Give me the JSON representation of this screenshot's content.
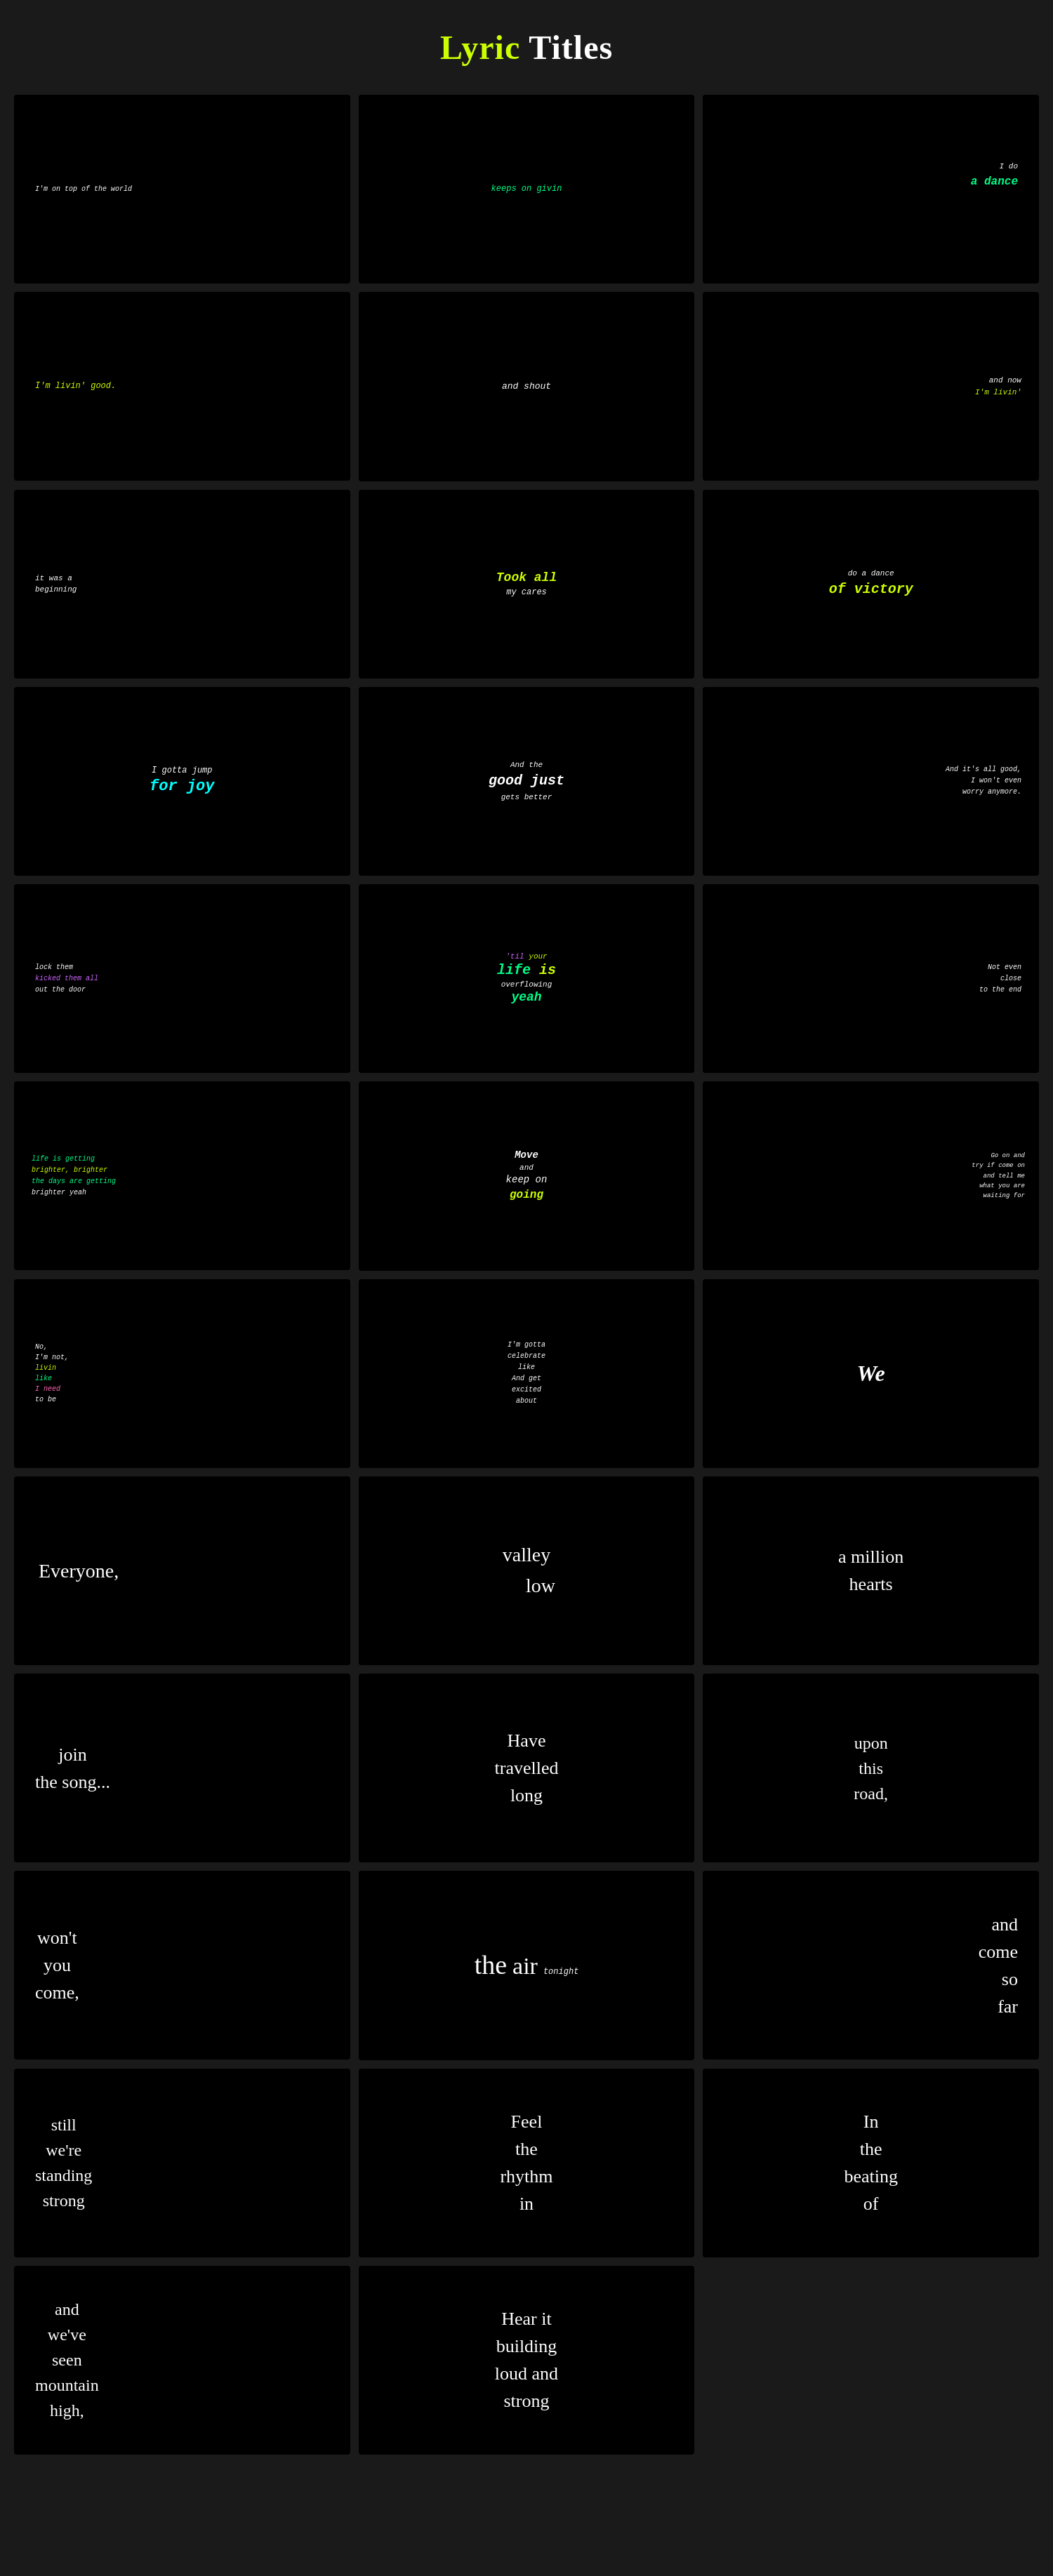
{
  "header": {
    "lyric": "Lyric",
    "titles": "Titles"
  },
  "cards": [
    {
      "id": 1,
      "lines": [
        {
          "text": "I'm on top of the world",
          "color": "white",
          "style": "italic small"
        }
      ],
      "align": "center",
      "position": "center-left"
    },
    {
      "id": 2,
      "lines": [
        {
          "text": "keeps on givin",
          "color": "green",
          "style": "italic"
        }
      ],
      "align": "center",
      "position": "center"
    },
    {
      "id": 3,
      "lines": [
        {
          "text": "I do",
          "color": "white",
          "style": "italic"
        },
        {
          "text": "a dance",
          "color": "green",
          "style": "italic bold"
        }
      ],
      "align": "right",
      "position": "top-right"
    },
    {
      "id": 4,
      "lines": [
        {
          "text": "I'm livin' good.",
          "color": "yellow",
          "style": "italic small"
        }
      ],
      "align": "left",
      "position": "center"
    },
    {
      "id": 5,
      "lines": [
        {
          "text": "and shout",
          "color": "white",
          "style": "italic"
        }
      ],
      "align": "center",
      "position": "center"
    },
    {
      "id": 6,
      "lines": [
        {
          "text": "and now",
          "color": "white",
          "style": "italic small"
        },
        {
          "text": "I'm livin'",
          "color": "yellow",
          "style": "italic small"
        }
      ],
      "align": "right",
      "position": "center"
    },
    {
      "id": 7,
      "lines": [
        {
          "text": "it was a",
          "color": "white",
          "style": "italic small"
        },
        {
          "text": "beginning",
          "color": "white",
          "style": "italic small"
        }
      ],
      "align": "left",
      "position": "center"
    },
    {
      "id": 8,
      "lines": [
        {
          "text": "Took all",
          "color": "yellow",
          "style": "bold-italic large"
        },
        {
          "text": "my cares",
          "color": "white",
          "style": "italic"
        }
      ],
      "align": "center",
      "position": "center"
    },
    {
      "id": 9,
      "lines": [
        {
          "text": "do a dance",
          "color": "white",
          "style": "italic small"
        },
        {
          "text": "of victory",
          "color": "yellow",
          "style": "bold-italic large"
        }
      ],
      "align": "center",
      "position": "center"
    },
    {
      "id": 10,
      "lines": [
        {
          "text": "I gotta jump",
          "color": "white",
          "style": "italic"
        },
        {
          "text": "for joy",
          "color": "cyan",
          "style": "bold-italic large"
        }
      ],
      "align": "center",
      "position": "center"
    },
    {
      "id": 11,
      "lines": [
        {
          "text": "And the",
          "color": "white",
          "style": "italic small"
        },
        {
          "text": "good just",
          "color": "white",
          "style": "bold-italic large"
        },
        {
          "text": "gets better",
          "color": "white",
          "style": "italic small"
        }
      ],
      "align": "center",
      "position": "center"
    },
    {
      "id": 12,
      "lines": [
        {
          "text": "And it's all good,",
          "color": "white",
          "style": "italic small"
        },
        {
          "text": "I won't even",
          "color": "white",
          "style": "italic small"
        },
        {
          "text": "worry anymore.",
          "color": "white",
          "style": "italic small"
        }
      ],
      "align": "right",
      "position": "center"
    },
    {
      "id": 13,
      "lines": [
        {
          "text": "lock them",
          "color": "white",
          "style": "italic small"
        },
        {
          "text": "kicked them all",
          "color": "purple",
          "style": "italic small"
        },
        {
          "text": "out the door",
          "color": "white",
          "style": "italic small"
        }
      ],
      "align": "left",
      "position": "center"
    },
    {
      "id": 14,
      "lines": [
        {
          "text": "'til your",
          "color": "multi",
          "style": "italic small"
        },
        {
          "text": "life is",
          "color": "multi",
          "style": "bold-italic large"
        },
        {
          "text": "overflowing",
          "color": "white",
          "style": "italic small"
        },
        {
          "text": "yeah",
          "color": "green",
          "style": "bold-italic large"
        }
      ],
      "align": "center",
      "position": "center"
    },
    {
      "id": 15,
      "lines": [
        {
          "text": "Not even",
          "color": "white",
          "style": "italic small"
        },
        {
          "text": "close",
          "color": "white",
          "style": "italic small"
        },
        {
          "text": "to the end",
          "color": "white",
          "style": "italic small"
        }
      ],
      "align": "right",
      "position": "center"
    },
    {
      "id": 16,
      "lines": [
        {
          "text": "life is getting",
          "color": "green",
          "style": "italic small"
        },
        {
          "text": "brighter, brighter",
          "color": "yellow",
          "style": "italic small"
        },
        {
          "text": "the days are getting",
          "color": "green",
          "style": "italic small"
        },
        {
          "text": "brighter yeah",
          "color": "white",
          "style": "italic small"
        }
      ],
      "align": "left",
      "position": "center"
    },
    {
      "id": 17,
      "lines": [
        {
          "text": "Move",
          "color": "white",
          "style": "italic"
        },
        {
          "text": "and",
          "color": "white",
          "style": "italic small"
        },
        {
          "text": "keep on",
          "color": "white",
          "style": "italic"
        },
        {
          "text": "going",
          "color": "yellow",
          "style": "bold-italic"
        }
      ],
      "align": "center",
      "position": "center"
    },
    {
      "id": 18,
      "lines": [
        {
          "text": "Go on and",
          "color": "white",
          "style": "italic small"
        },
        {
          "text": "try if come on",
          "color": "white",
          "style": "italic small"
        },
        {
          "text": "and tell me",
          "color": "white",
          "style": "italic small"
        },
        {
          "text": "what you are",
          "color": "white",
          "style": "italic small"
        },
        {
          "text": "waiting for",
          "color": "white",
          "style": "italic small"
        }
      ],
      "align": "right",
      "position": "center"
    },
    {
      "id": 19,
      "lines": [
        {
          "text": "No,",
          "color": "white",
          "style": "italic small"
        },
        {
          "text": "I'm not,",
          "color": "white",
          "style": "italic small"
        },
        {
          "text": "livin",
          "color": "yellow",
          "style": "italic small"
        },
        {
          "text": "like",
          "color": "green",
          "style": "italic small"
        },
        {
          "text": "I need",
          "color": "pink",
          "style": "italic small"
        },
        {
          "text": "to be",
          "color": "white",
          "style": "italic small"
        }
      ],
      "align": "left",
      "position": "center"
    },
    {
      "id": 20,
      "lines": [
        {
          "text": "I'm gotta",
          "color": "white",
          "style": "italic small"
        },
        {
          "text": "celebrate",
          "color": "white",
          "style": "italic small"
        },
        {
          "text": "like",
          "color": "white",
          "style": "italic small"
        },
        {
          "text": "And get",
          "color": "white",
          "style": "italic small"
        },
        {
          "text": "excited",
          "color": "white",
          "style": "italic small"
        },
        {
          "text": "about",
          "color": "white",
          "style": "italic small"
        }
      ],
      "align": "center",
      "position": "center"
    },
    {
      "id": 21,
      "lines": [
        {
          "text": "We",
          "color": "white",
          "style": "bold large"
        }
      ],
      "align": "center",
      "position": "center"
    },
    {
      "id": 22,
      "lines": [
        {
          "text": "Everyone,",
          "color": "white",
          "style": "handwrite large"
        }
      ],
      "align": "left",
      "position": "center"
    },
    {
      "id": 23,
      "lines": [
        {
          "text": "valley",
          "color": "white",
          "style": "handwrite large"
        },
        {
          "text": "low",
          "color": "white",
          "style": "handwrite large"
        }
      ],
      "align": "center",
      "position": "center"
    },
    {
      "id": 24,
      "lines": [
        {
          "text": "a million",
          "color": "white",
          "style": "handwrite large"
        },
        {
          "text": "hearts",
          "color": "white",
          "style": "handwrite large"
        }
      ],
      "align": "center",
      "position": "center"
    },
    {
      "id": 25,
      "lines": [
        {
          "text": "join",
          "color": "white",
          "style": "handwrite large"
        },
        {
          "text": "the song...",
          "color": "white",
          "style": "handwrite large"
        }
      ],
      "align": "left",
      "position": "center"
    },
    {
      "id": 26,
      "lines": [
        {
          "text": "Have",
          "color": "white",
          "style": "handwrite large"
        },
        {
          "text": "travelled",
          "color": "white",
          "style": "handwrite large"
        },
        {
          "text": "long",
          "color": "white",
          "style": "handwrite large"
        }
      ],
      "align": "center",
      "position": "center"
    },
    {
      "id": 27,
      "lines": [
        {
          "text": "upon",
          "color": "white",
          "style": "handwrite large"
        },
        {
          "text": "this",
          "color": "white",
          "style": "handwrite large"
        },
        {
          "text": "road,",
          "color": "white",
          "style": "handwrite large"
        }
      ],
      "align": "center",
      "position": "center"
    },
    {
      "id": 28,
      "lines": [
        {
          "text": "won't",
          "color": "white",
          "style": "handwrite large"
        },
        {
          "text": "you",
          "color": "white",
          "style": "handwrite large"
        },
        {
          "text": "come,",
          "color": "white",
          "style": "handwrite large"
        }
      ],
      "align": "left",
      "position": "center"
    },
    {
      "id": 29,
      "lines": [
        {
          "text": "the",
          "color": "white",
          "style": "handwrite xlarge"
        },
        {
          "text": "air tonight",
          "color": "white",
          "style": "handwrite small-sup"
        }
      ],
      "align": "center",
      "position": "center"
    },
    {
      "id": 30,
      "lines": [
        {
          "text": "and",
          "color": "white",
          "style": "handwrite large"
        },
        {
          "text": "come",
          "color": "white",
          "style": "handwrite large"
        },
        {
          "text": "so",
          "color": "white",
          "style": "handwrite large"
        },
        {
          "text": "far",
          "color": "white",
          "style": "handwrite large"
        }
      ],
      "align": "right",
      "position": "center"
    },
    {
      "id": 31,
      "lines": [
        {
          "text": "still",
          "color": "white",
          "style": "handwrite large"
        },
        {
          "text": "we're",
          "color": "white",
          "style": "handwrite large"
        },
        {
          "text": "standing",
          "color": "white",
          "style": "handwrite large"
        },
        {
          "text": "strong",
          "color": "white",
          "style": "handwrite large"
        }
      ],
      "align": "left",
      "position": "center"
    },
    {
      "id": 32,
      "lines": [
        {
          "text": "Feel",
          "color": "white",
          "style": "handwrite large"
        },
        {
          "text": "the",
          "color": "white",
          "style": "handwrite large"
        },
        {
          "text": "rhythm",
          "color": "white",
          "style": "handwrite large"
        },
        {
          "text": "in",
          "color": "white",
          "style": "handwrite large"
        }
      ],
      "align": "center",
      "position": "center"
    },
    {
      "id": 33,
      "lines": [
        {
          "text": "In",
          "color": "white",
          "style": "handwrite large"
        },
        {
          "text": "the",
          "color": "white",
          "style": "handwrite large"
        },
        {
          "text": "beating",
          "color": "white",
          "style": "handwrite large"
        },
        {
          "text": "of",
          "color": "white",
          "style": "handwrite large"
        }
      ],
      "align": "center",
      "position": "center"
    },
    {
      "id": 34,
      "lines": [
        {
          "text": "and",
          "color": "white",
          "style": "handwrite large"
        },
        {
          "text": "we've",
          "color": "white",
          "style": "handwrite large"
        },
        {
          "text": "seen",
          "color": "white",
          "style": "handwrite large"
        },
        {
          "text": "mountain",
          "color": "white",
          "style": "handwrite large"
        },
        {
          "text": "high,",
          "color": "white",
          "style": "handwrite large"
        }
      ],
      "align": "left",
      "position": "center"
    },
    {
      "id": 35,
      "lines": [
        {
          "text": "Hear it",
          "color": "white",
          "style": "handwrite large"
        },
        {
          "text": "building",
          "color": "white",
          "style": "handwrite large"
        },
        {
          "text": "loud and",
          "color": "white",
          "style": "handwrite large"
        },
        {
          "text": "strong",
          "color": "white",
          "style": "handwrite large"
        }
      ],
      "align": "center",
      "position": "center"
    }
  ]
}
